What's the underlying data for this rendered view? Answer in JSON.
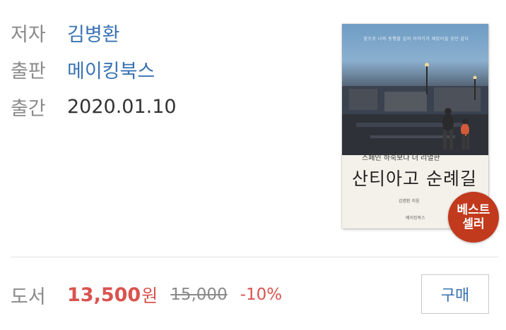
{
  "book": {
    "author_label": "저자",
    "author": "김병환",
    "publisher_label": "출판",
    "publisher": "메이킹북스",
    "date_label": "출간",
    "date": "2020.01.10"
  },
  "cover": {
    "tagline": "앞으로 나와 동행할 길의 이야기가 재밌어질 것만 같다",
    "subtitle": "스페인 하숙보다 더 리얼한",
    "title": "산티아고 순례길",
    "author": "김병환 지음",
    "publisher": "메이킹북스"
  },
  "badge": {
    "line1": "베스트",
    "line2": "셀러"
  },
  "price": {
    "label": "도서",
    "sale": "13,500",
    "unit": "원",
    "original": "15,000",
    "discount": "-10%"
  },
  "actions": {
    "buy_label": "구매"
  }
}
